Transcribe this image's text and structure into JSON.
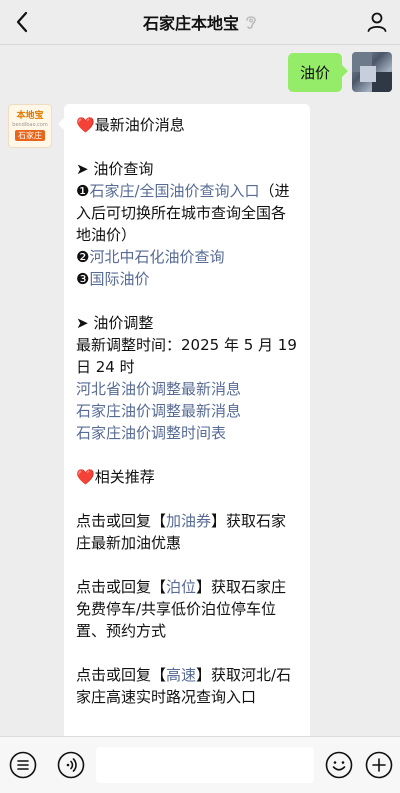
{
  "header": {
    "title": "石家庄本地宝"
  },
  "outgoing": {
    "text": "油价"
  },
  "account_logo": {
    "brand": "本地宝",
    "sub": "bendibao.com",
    "city": "石家庄"
  },
  "reply": {
    "heading_emoji": "❤️",
    "heading": "最新油价消息",
    "section1_title": "➤ 油价查询",
    "item1_marker": "❶",
    "item1_link": "石家庄/全国油价查询入口",
    "item1_rest": "（进入后可切换所在城市查询全国各地油价）",
    "item2_marker": "❷",
    "item2_link": "河北中石化油价查询",
    "item3_marker": "❸",
    "item3_link": "国际油价",
    "section2_title": "➤ 油价调整",
    "adjust_time": "最新调整时间：2025 年 5 月 19 日 24 时",
    "link_a": "河北省油价调整最新消息",
    "link_b": "石家庄油价调整最新消息",
    "link_c": "石家庄油价调整时间表",
    "related_emoji": "❤️",
    "related_title": "相关推荐",
    "p1_pre": "点击或回复【",
    "p1_link": "加油券",
    "p1_post": "】获取石家庄最新加油优惠",
    "p2_pre": "点击或回复【",
    "p2_link": "泊位",
    "p2_post": "】获取石家庄免费停车/共享低价泊位停车位置、预约方式",
    "p3_pre": "点击或回复【",
    "p3_link": "高速",
    "p3_post": "】获取河北/石家庄高速实时路况查询入口"
  },
  "input": {
    "value": ""
  }
}
